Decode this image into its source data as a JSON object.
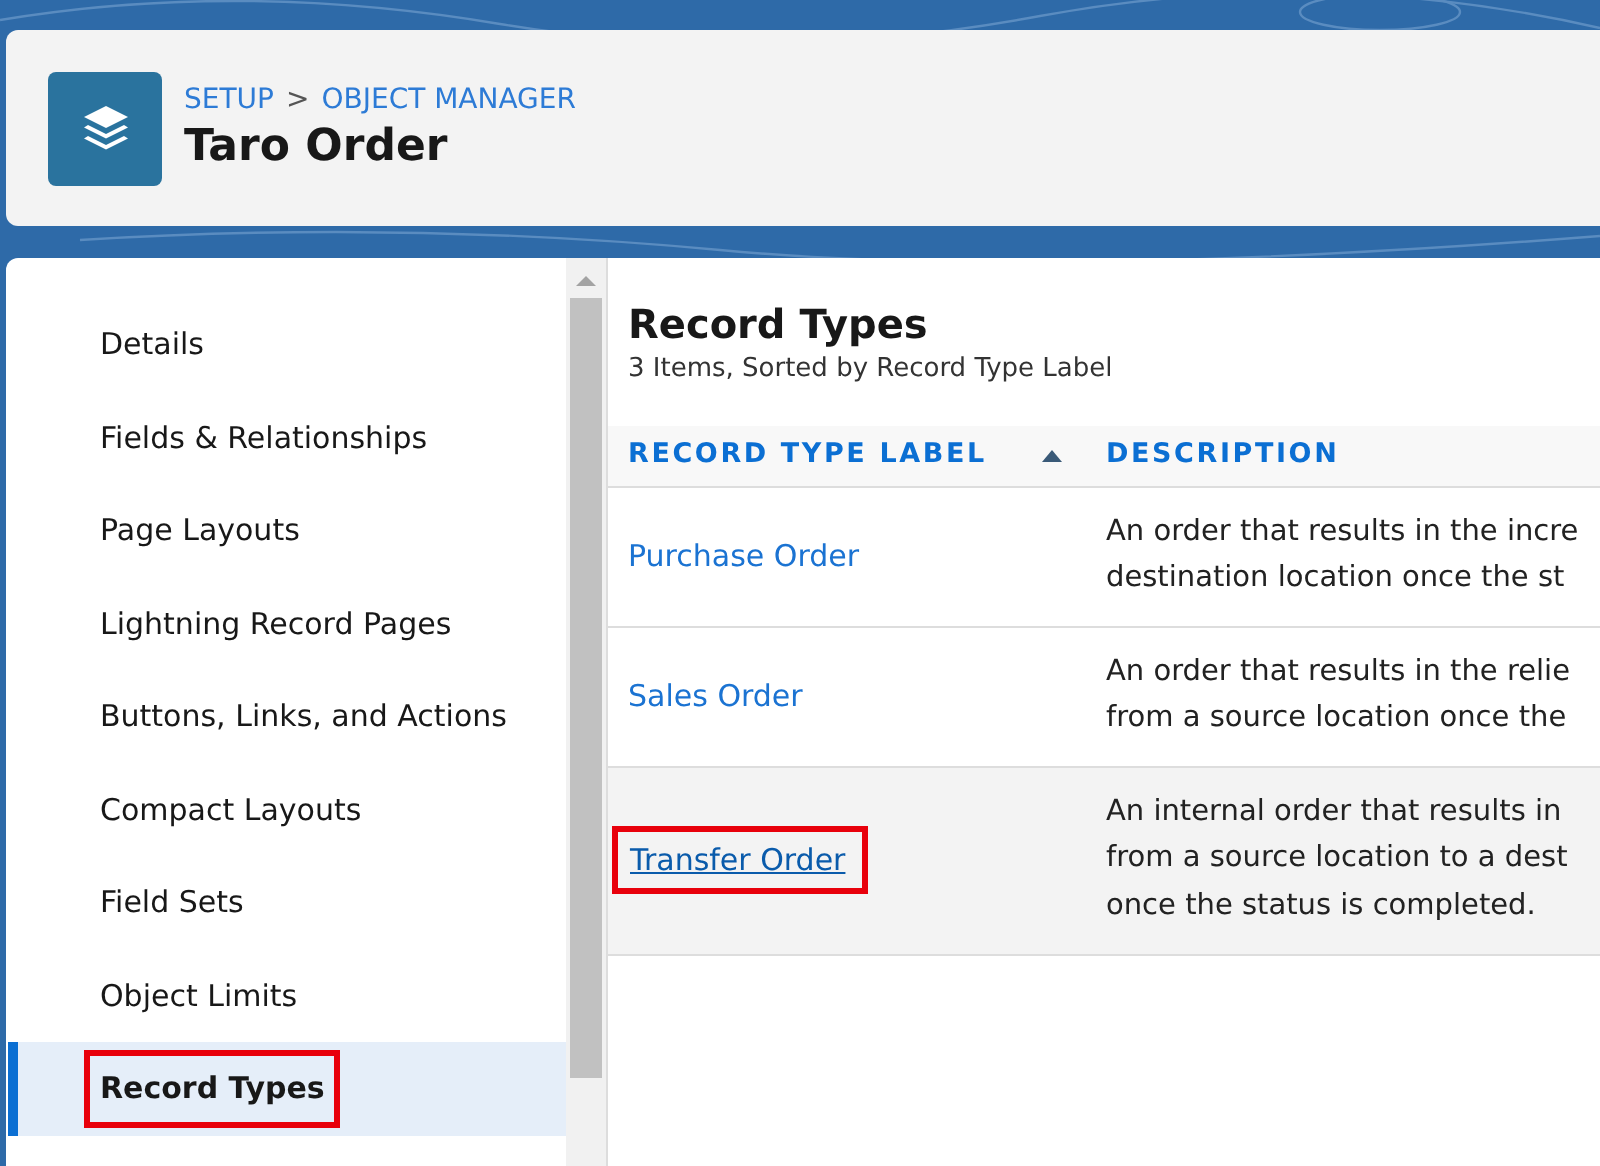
{
  "header": {
    "breadcrumb": [
      "SETUP",
      "OBJECT MANAGER"
    ],
    "separator": ">",
    "title": "Taro Order"
  },
  "sidebar": {
    "items": [
      {
        "label": "Details",
        "selected": false,
        "annotated": false
      },
      {
        "label": "Fields & Relationships",
        "selected": false,
        "annotated": false
      },
      {
        "label": "Page Layouts",
        "selected": false,
        "annotated": false
      },
      {
        "label": "Lightning Record Pages",
        "selected": false,
        "annotated": false
      },
      {
        "label": "Buttons, Links, and Actions",
        "selected": false,
        "annotated": false
      },
      {
        "label": "Compact Layouts",
        "selected": false,
        "annotated": false
      },
      {
        "label": "Field Sets",
        "selected": false,
        "annotated": false
      },
      {
        "label": "Object Limits",
        "selected": false,
        "annotated": false
      },
      {
        "label": "Record Types",
        "selected": true,
        "annotated": true
      }
    ]
  },
  "content": {
    "title": "Record Types",
    "subtitle": "3 Items, Sorted by Record Type Label",
    "table": {
      "columns": [
        {
          "label": "RECORD TYPE LABEL",
          "sorted": true
        },
        {
          "label": "DESCRIPTION",
          "sorted": false
        }
      ],
      "rows": [
        {
          "label": "Purchase Order",
          "description": [
            "An order that results in the incre",
            "destination location once the st"
          ],
          "hovered": false,
          "annotated": false
        },
        {
          "label": "Sales Order",
          "description": [
            "An order that results in the relie",
            "from a source location once the"
          ],
          "hovered": false,
          "annotated": false
        },
        {
          "label": "Transfer Order",
          "description": [
            "An internal order that results in",
            "from a source location to a dest",
            "once the status is completed."
          ],
          "hovered": true,
          "annotated": true
        }
      ]
    }
  }
}
